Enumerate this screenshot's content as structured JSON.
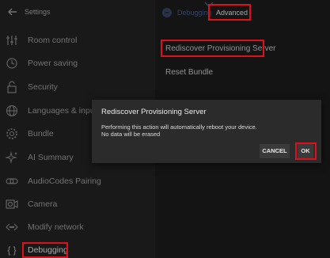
{
  "sidebar": {
    "title": "Settings",
    "items": [
      {
        "label": "Room control",
        "icon": "sliders-icon"
      },
      {
        "label": "Power saving",
        "icon": "clock-icon"
      },
      {
        "label": "Security",
        "icon": "lock-icon"
      },
      {
        "label": "Languages & input",
        "icon": "globe-icon"
      },
      {
        "label": "Bundle",
        "icon": "gear-icon"
      },
      {
        "label": "AI Summary",
        "icon": "sparkle-icon"
      },
      {
        "label": "AudioCodes Pairing",
        "icon": "pairing-icon"
      },
      {
        "label": "Camera",
        "icon": "camera-icon"
      },
      {
        "label": "Modify network",
        "icon": "network-icon"
      },
      {
        "label": "Debugging",
        "icon": "braces-icon"
      }
    ]
  },
  "main": {
    "tabs": [
      {
        "label": "Debugging"
      },
      {
        "label": "Advanced"
      }
    ],
    "items": [
      {
        "label": "Rediscover Provisioning Server"
      },
      {
        "label": "Reset Bundle"
      }
    ]
  },
  "dialog": {
    "title": "Rediscover Provisioning Server",
    "line1": "Performing this action will automatically reboot your device.",
    "line2": "No data will be erased",
    "cancel_label": "CANCEL",
    "ok_label": "OK"
  },
  "colors": {
    "highlight": "#e0101a",
    "background": "#1c1c1c",
    "sidebar": "#232323",
    "dialog": "#2b2b2b"
  }
}
